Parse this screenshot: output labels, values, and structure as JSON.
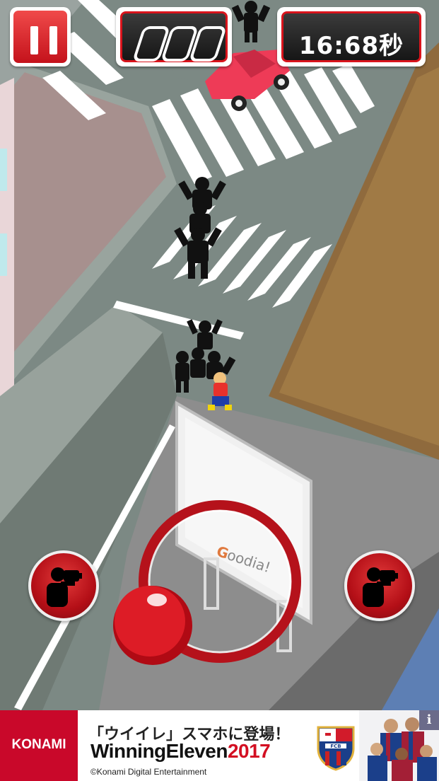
{
  "hud": {
    "pause_icon": "pause-icon",
    "counter_slots": 3,
    "timer": "16:68秒"
  },
  "scene": {
    "billboard_text": "oodia!",
    "billboard_logo_letter": "G"
  },
  "controls": {
    "left_button_icon": "camera-person-icon",
    "right_button_icon": "camera-person-icon",
    "joystick_icon": "joystick-ball"
  },
  "ad": {
    "brand": "KONAMI",
    "headline": "「ウイイレ」スマホに登場！",
    "product_name": "WinningEleven",
    "product_year": "2017",
    "copyright": "©Konami Digital Entertainment",
    "info_label": "i",
    "club_badge": "FCB"
  },
  "colors": {
    "accent_red": "#d9141c",
    "road_gray": "#7f8b84",
    "ad_brand_red": "#c9082a"
  }
}
